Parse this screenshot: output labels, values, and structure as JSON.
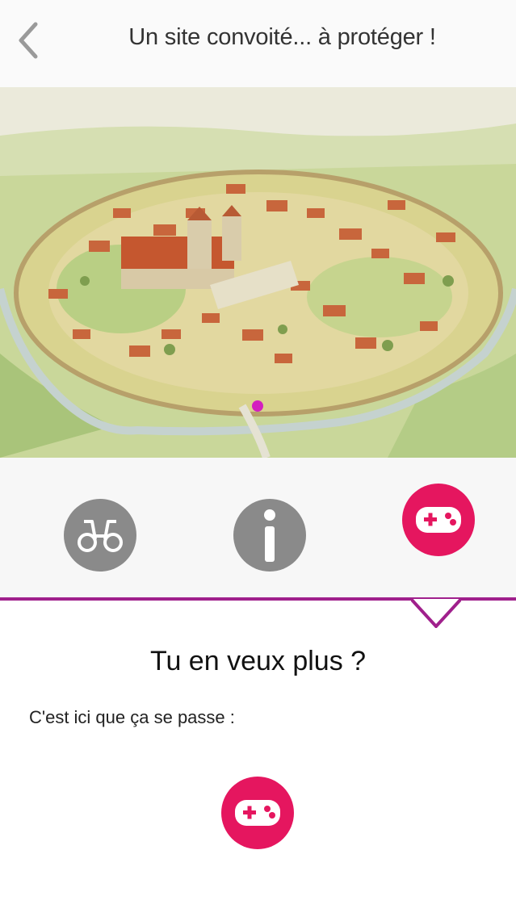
{
  "header": {
    "title": "Un site convoité... à protéger !"
  },
  "colors": {
    "accent": "#e5165f",
    "divider": "#a0208c",
    "inactive_icon": "#8a8a8a"
  },
  "icons": {
    "back": "chevron-left-icon",
    "explore": "binoculars-icon",
    "info": "info-icon",
    "game": "gamepad-icon"
  },
  "content": {
    "heading": "Tu en veux plus ?",
    "intro": "C'est ici que ça se passe :"
  }
}
